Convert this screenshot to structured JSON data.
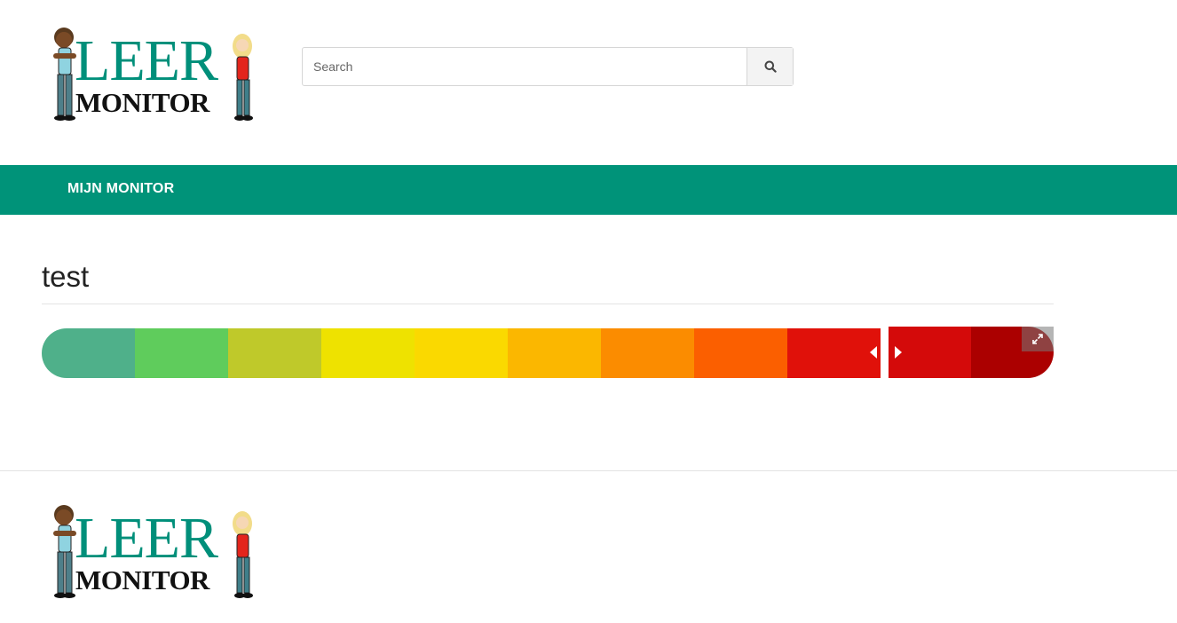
{
  "header": {
    "logo_line1": "LEER",
    "logo_line2": "MONITOR"
  },
  "search": {
    "placeholder": "Search",
    "value": "",
    "button_icon": "search-icon"
  },
  "nav": {
    "items": [
      {
        "label": "MIJN MONITOR"
      }
    ],
    "color": "#009379"
  },
  "content": {
    "title": "test"
  },
  "gallery": {
    "main_colors": [
      "#4fb08a",
      "#5fcc5c",
      "#bfc92a",
      "#eee200",
      "#fad900",
      "#fbb700",
      "#fb8c00",
      "#fb5f00",
      "#e0110a"
    ],
    "side_colors": [
      "#d40a0a",
      "#ab0000"
    ],
    "prev_icon": "caret-left-icon",
    "next_icon": "caret-right-icon",
    "expand_icon": "expand-icon"
  },
  "footer": {
    "logo_line1": "LEER",
    "logo_line2": "MONITOR"
  }
}
